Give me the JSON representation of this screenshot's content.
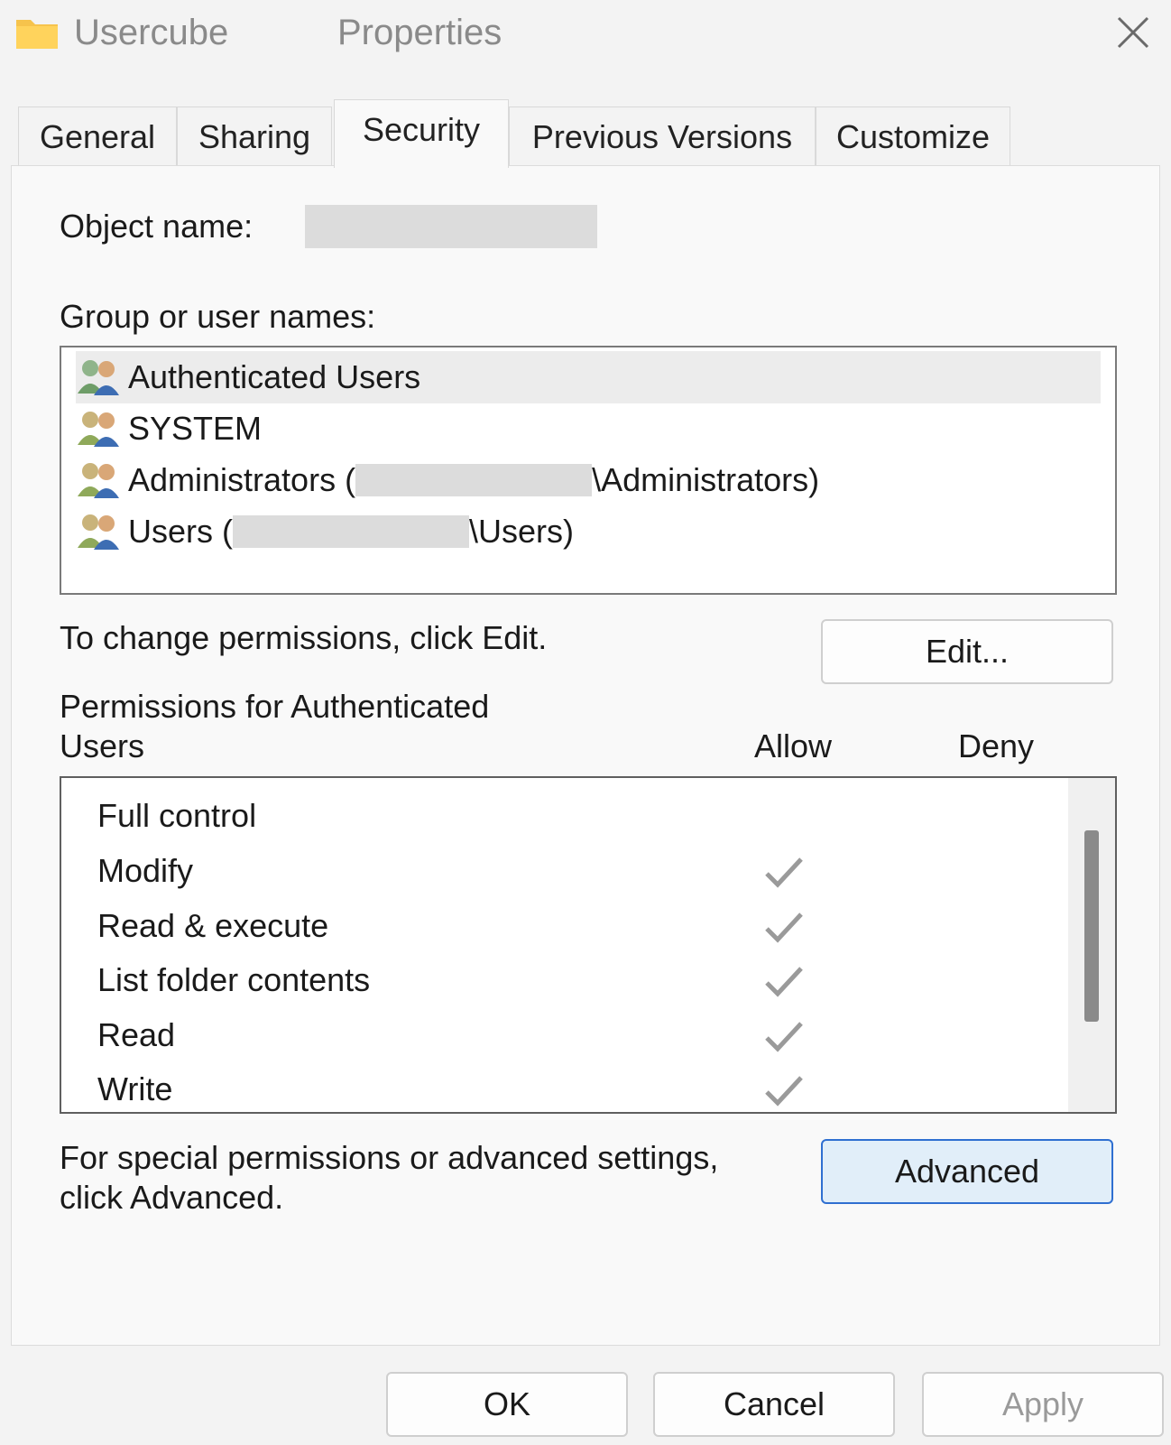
{
  "window": {
    "title_name": "Usercube",
    "title_suffix": "Properties",
    "close_icon": "close-icon"
  },
  "tabs": [
    {
      "label": "General"
    },
    {
      "label": "Sharing"
    },
    {
      "label": "Security",
      "active": true
    },
    {
      "label": "Previous Versions"
    },
    {
      "label": "Customize"
    }
  ],
  "security": {
    "object_name_label": "Object name:",
    "group_label": "Group or user names:",
    "users": [
      {
        "name": "Authenticated Users",
        "selected": true
      },
      {
        "name": "SYSTEM"
      },
      {
        "prefix": "Administrators (",
        "suffix": "\\Administrators)"
      },
      {
        "prefix": "Users (",
        "suffix": "\\Users)"
      }
    ],
    "change_hint": "To change permissions, click Edit.",
    "edit_button": "Edit...",
    "perm_header_line1": "Permissions for Authenticated",
    "perm_header_line2": "Users",
    "allow_header": "Allow",
    "deny_header": "Deny",
    "permissions": [
      {
        "name": "Full control",
        "allow": false,
        "deny": false
      },
      {
        "name": "Modify",
        "allow": true,
        "deny": false
      },
      {
        "name": "Read & execute",
        "allow": true,
        "deny": false
      },
      {
        "name": "List folder contents",
        "allow": true,
        "deny": false
      },
      {
        "name": "Read",
        "allow": true,
        "deny": false
      },
      {
        "name": "Write",
        "allow": true,
        "deny": false
      }
    ],
    "advanced_hint_line1": "For special permissions or advanced settings,",
    "advanced_hint_line2": "click Advanced.",
    "advanced_button": "Advanced"
  },
  "footer": {
    "ok": "OK",
    "cancel": "Cancel",
    "apply": "Apply"
  },
  "colors": {
    "accent": "#2f6fd1",
    "folder": "#f6c34c"
  }
}
